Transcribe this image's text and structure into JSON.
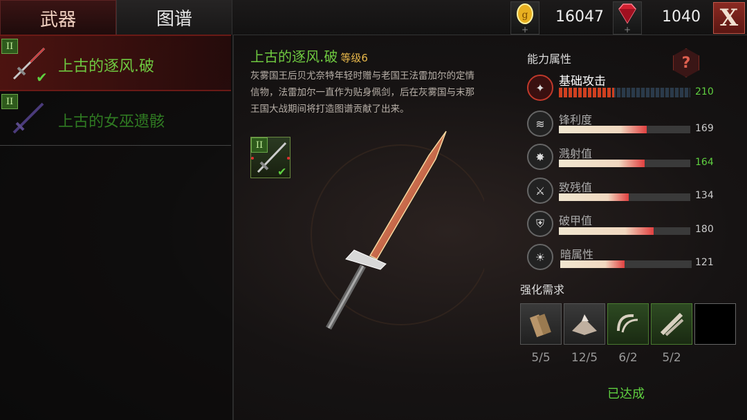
{
  "tabs": [
    {
      "label": "武器"
    },
    {
      "label": "图谱"
    }
  ],
  "resources": {
    "gold": "16047",
    "gems": "1040"
  },
  "close_label": "X",
  "weapon_list": [
    {
      "name": "上古的逐风.破",
      "tier": "II",
      "selected": true,
      "color": "#6ec840"
    },
    {
      "name": "上古的女巫遗骸",
      "tier": "II",
      "selected": false,
      "color": "#2f7a22"
    }
  ],
  "detail": {
    "name": "上古的逐风.破",
    "level": "等级6",
    "description": "灰雾国王后贝尤奈特年轻时赠与老国王法雷加尔的定情信物，法雷加尔一直作为贴身佩剑，后在灰雾国与末那王国大战期间将打造图谱贡献了出来。",
    "thumb_tier": "II"
  },
  "attributes": {
    "title": "能力属性",
    "help": "?",
    "stats": [
      {
        "icon": "attack-icon",
        "label": "基础攻击",
        "value": "210",
        "fill": 0.42,
        "highlight": true
      },
      {
        "icon": "sharpness-icon",
        "label": "锋利度",
        "value": "169",
        "fill": 0.67,
        "highlight": false
      },
      {
        "icon": "splash-icon",
        "label": "溅射值",
        "value": "164",
        "fill": 0.65,
        "highlight": true
      },
      {
        "icon": "cripple-icon",
        "label": "致残值",
        "value": "134",
        "fill": 0.53,
        "highlight": false
      },
      {
        "icon": "armor-break-icon",
        "label": "破甲值",
        "value": "180",
        "fill": 0.72,
        "highlight": false
      },
      {
        "icon": "dark-icon",
        "label": "暗属性",
        "value": "121",
        "fill": 0.49,
        "highlight": false
      }
    ]
  },
  "requirements": {
    "title": "强化需求",
    "materials": [
      {
        "icon": "wood-icon",
        "count": "5/5"
      },
      {
        "icon": "ore-icon",
        "count": "12/5"
      },
      {
        "icon": "claw-icon",
        "count": "6/2"
      },
      {
        "icon": "bone-icon",
        "count": "5/2"
      },
      {
        "icon": "empty-slot",
        "count": ""
      }
    ],
    "status": "已达成"
  },
  "colors": {
    "accent": "#6ec840",
    "gold": "#e8b84a",
    "red": "#c0392b"
  }
}
